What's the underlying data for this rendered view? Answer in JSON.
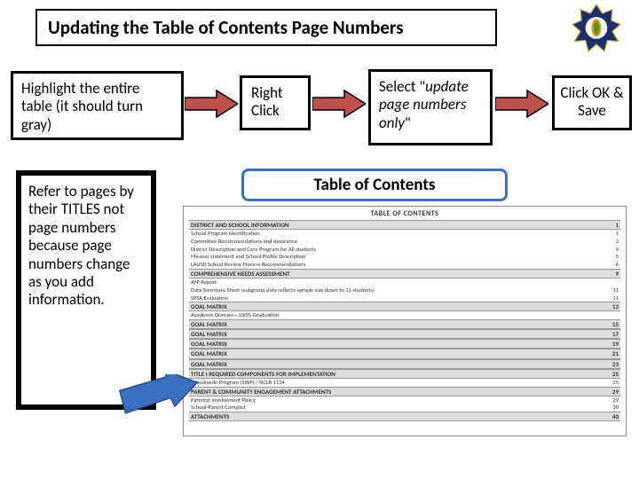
{
  "title": "Updating the Table of Contents Page Numbers",
  "steps": {
    "s1": "Highlight the entire table (it should turn gray)",
    "s2": "Right Click",
    "s3_pre": "Select \"",
    "s3_mid": "update page numbers only",
    "s3_post": "\"",
    "s4": "Click OK & Save"
  },
  "note": "Refer to pages by their TITLES not page numbers because page numbers change as you add information.",
  "toc_label": "Table of Contents",
  "toc": {
    "heading": "TABLE OF CONTENTS",
    "sections": [
      {
        "title": "DISTRICT AND SCHOOL INFORMATION",
        "page": "1",
        "items": [
          {
            "t": "School Program Identification",
            "p": "1"
          },
          {
            "t": "Committee Recommendations and Assurance",
            "p": "2"
          },
          {
            "t": "District Description and Core Program for All students",
            "p": "4"
          },
          {
            "t": "Mission statement and School Profile Description",
            "p": "5"
          },
          {
            "t": "LAUSD School Review Process Recommendations",
            "p": "6"
          }
        ]
      },
      {
        "title": "COMPREHENSIVE NEEDS ASSESSMENT",
        "page": "9",
        "items": [
          {
            "t": "AYP Report",
            "p": ""
          },
          {
            "t": "Data Summary Sheet (subgroup data reflects sample size down to 11 students)",
            "p": "11"
          },
          {
            "t": "SPSA Evaluation",
            "p": "11"
          }
        ]
      },
      {
        "title": "GOAL MATRIX",
        "page": "13",
        "items": [
          {
            "t": "Academic Domain—100% Graduation",
            "p": ""
          }
        ]
      },
      {
        "title": "GOAL MATRIX",
        "page": "15",
        "items": []
      },
      {
        "title": "GOAL MATRIX",
        "page": "17",
        "items": []
      },
      {
        "title": "GOAL MATRIX",
        "page": "19",
        "items": []
      },
      {
        "title": "GOAL MATRIX",
        "page": "21",
        "items": []
      },
      {
        "title": "GOAL MATRIX",
        "page": "23",
        "items": []
      },
      {
        "title": "TITLE I REQUIRED COMPONENTS FOR IMPLEMENTATION",
        "page": "25",
        "items": [
          {
            "t": "Schoolwide Program (SWP) / NCLB 1114",
            "p": "25"
          }
        ]
      },
      {
        "title": "PARENT & COMMUNITY ENGAGEMENT ATTACHMENTS",
        "page": "29",
        "items": [
          {
            "t": "Parental Involvement Policy",
            "p": "29"
          },
          {
            "t": "School-Parent Compact",
            "p": "30"
          }
        ]
      },
      {
        "title": "ATTACHMENTS",
        "page": "40",
        "items": []
      }
    ]
  }
}
